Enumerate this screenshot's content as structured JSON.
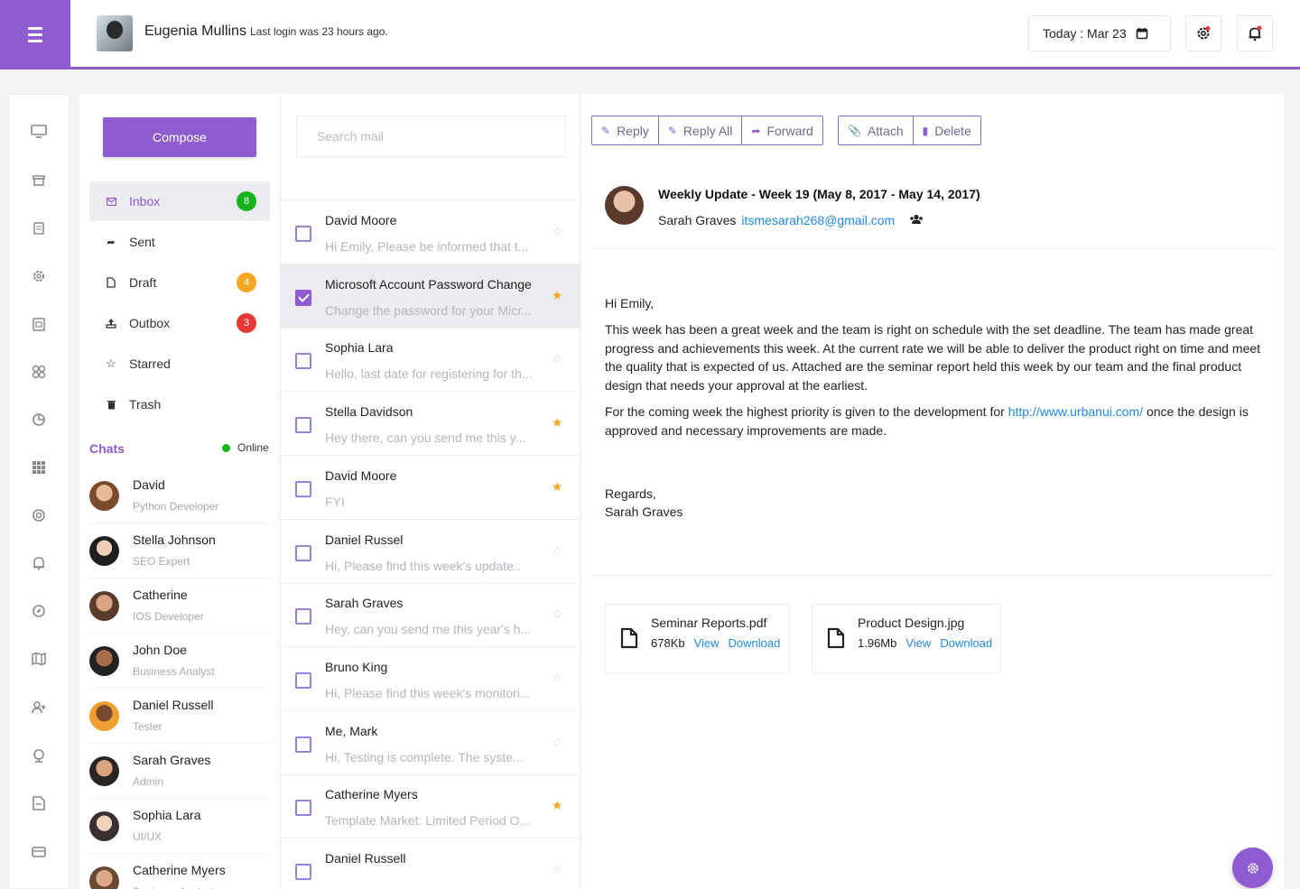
{
  "header": {
    "user_name": "Eugenia Mullins",
    "last_login": "Last login was 23 hours ago.",
    "date_label": "Today : Mar 23"
  },
  "rail": {
    "icons": [
      "monitor-icon",
      "archive-icon",
      "document-icon",
      "settings-icon",
      "calendar-icon",
      "grid-icon",
      "pie-chart-icon",
      "apps-icon",
      "target-icon",
      "bell-icon",
      "compass-icon",
      "map-icon",
      "user-plus-icon",
      "globe-icon",
      "file-icon",
      "box-icon"
    ]
  },
  "folders": {
    "compose_label": "Compose",
    "items": [
      {
        "label": "Inbox",
        "badge": "8",
        "badge_color": "#19b31b"
      },
      {
        "label": "Sent",
        "badge": "",
        "badge_color": ""
      },
      {
        "label": "Draft",
        "badge": "4",
        "badge_color": "#f5a623"
      },
      {
        "label": "Outbox",
        "badge": "3",
        "badge_color": "#e53935"
      },
      {
        "label": "Starred",
        "badge": "",
        "badge_color": ""
      },
      {
        "label": "Trash",
        "badge": "",
        "badge_color": ""
      }
    ]
  },
  "chats": {
    "title": "Chats",
    "status": "Online",
    "people": [
      {
        "name": "David",
        "role": "Python Developer"
      },
      {
        "name": "Stella Johnson",
        "role": "SEO Expert"
      },
      {
        "name": "Catherine",
        "role": "IOS Developer"
      },
      {
        "name": "John Doe",
        "role": "Business Analyst"
      },
      {
        "name": "Daniel Russell",
        "role": "Tester"
      },
      {
        "name": "Sarah Graves",
        "role": "Admin"
      },
      {
        "name": "Sophia Lara",
        "role": "UI/UX"
      },
      {
        "name": "Catherine Myers",
        "role": "Business Analyst"
      }
    ]
  },
  "mail_list": {
    "search_placeholder": "Search mail",
    "items": [
      {
        "from": "David Moore",
        "snippet": "Hi Emily, Please be informed that t...",
        "starred": false,
        "checked": false
      },
      {
        "from": "Microsoft Account Password Change",
        "snippet": "Change the password for your Micr...",
        "starred": true,
        "checked": true
      },
      {
        "from": "Sophia Lara",
        "snippet": "Hello, last date for registering for th...",
        "starred": false,
        "checked": false
      },
      {
        "from": "Stella Davidson",
        "snippet": "Hey there, can you send me this y...",
        "starred": true,
        "checked": false
      },
      {
        "from": "David Moore",
        "snippet": "FYI",
        "starred": true,
        "checked": false
      },
      {
        "from": "Daniel Russel",
        "snippet": "Hi, Please find this week's update..",
        "starred": false,
        "checked": false
      },
      {
        "from": "Sarah Graves",
        "snippet": "Hey, can you send me this year's h...",
        "starred": false,
        "checked": false
      },
      {
        "from": "Bruno King",
        "snippet": "Hi, Please find this week's monitori...",
        "starred": false,
        "checked": false
      },
      {
        "from": "Me, Mark",
        "snippet": "Hi, Testing is complete. The syste...",
        "starred": false,
        "checked": false
      },
      {
        "from": "Catherine Myers",
        "snippet": "Template Market: Limited Period O...",
        "starred": true,
        "checked": false
      },
      {
        "from": "Daniel Russell",
        "snippet": "",
        "starred": false,
        "checked": false
      }
    ]
  },
  "toolbar": {
    "reply": "Reply",
    "reply_all": "Reply All",
    "forward": "Forward",
    "attach": "Attach",
    "delete": "Delete"
  },
  "message": {
    "subject": "Weekly Update - Week 19 (May 8, 2017 - May 14, 2017)",
    "sender_name": "Sarah Graves",
    "sender_email": "itsmesarah268@gmail.com",
    "greeting": "Hi Emily,",
    "paragraph1": "This week has been a great week and the team is right on schedule with the set deadline. The team has made great progress and achievements this week. At the current rate we will be able to deliver the product right on time and meet the quality that is expected of us. Attached are the seminar report held this week by our team and the final product design that needs your approval at the earliest.",
    "paragraph2_before": "For the coming week the highest priority is given to the development for",
    "paragraph2_link": "http://www.urbanui.com/",
    "paragraph2_after": "once the design is approved and necessary improvements are made.",
    "closing": "Regards,",
    "signature": "Sarah Graves"
  },
  "attachments": [
    {
      "name": "Seminar Reports.pdf",
      "size": "678Kb",
      "view": "View",
      "download": "Download"
    },
    {
      "name": "Product Design.jpg",
      "size": "1.96Mb",
      "view": "View",
      "download": "Download"
    }
  ],
  "colors": {
    "accent": "#8e5bd1",
    "link": "#1e88e5",
    "star": "#f5a623"
  }
}
